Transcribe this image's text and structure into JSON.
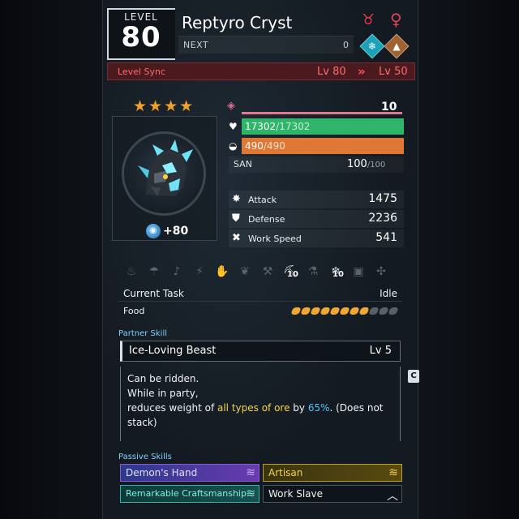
{
  "header": {
    "level_label": "LEVEL",
    "level": "80",
    "name": "Reptyro Cryst",
    "next_label": "NEXT",
    "next_value": "0",
    "level_sync_label": "Level Sync",
    "sync_from": "Lv 80",
    "sync_to": "Lv 50"
  },
  "icons": {
    "alpha": "alpha-icon",
    "gender": "female-icon",
    "element_1": "ice-element-icon",
    "element_2": "ground-element-icon"
  },
  "colors": {
    "ice_element": "#1aa3b8",
    "ground_element": "#a0622f",
    "hp_bar": "#2fb56a",
    "sp_bar": "#e07835",
    "sync_bar": "#4a1a1f"
  },
  "portrait": {
    "stars": "★★★★",
    "star_count": 4,
    "souls_bonus": "+80"
  },
  "stats": {
    "rank": "10",
    "hp_current": "17302",
    "hp_max": "/17302",
    "sp_current": "490",
    "sp_max": "/490",
    "san_label": "SAN",
    "san_value": "100",
    "san_max": "/100",
    "attack_label": "Attack",
    "attack": "1475",
    "defense_label": "Defense",
    "defense": "2236",
    "work_speed_label": "Work Speed",
    "work_speed": "541"
  },
  "work": {
    "icons": [
      {
        "name": "kindling-icon",
        "glyph": "♨",
        "active": false,
        "level": ""
      },
      {
        "name": "watering-icon",
        "glyph": "☂",
        "active": false,
        "level": ""
      },
      {
        "name": "planting-icon",
        "glyph": "♪",
        "active": false,
        "level": ""
      },
      {
        "name": "electricity-icon",
        "glyph": "⚡",
        "active": false,
        "level": ""
      },
      {
        "name": "handiwork-icon",
        "glyph": "✋",
        "active": false,
        "level": ""
      },
      {
        "name": "gathering-icon",
        "glyph": "❦",
        "active": false,
        "level": ""
      },
      {
        "name": "lumbering-icon",
        "glyph": "⚒",
        "active": false,
        "level": ""
      },
      {
        "name": "mining-icon",
        "glyph": "⛏",
        "active": true,
        "level": "10"
      },
      {
        "name": "medicine-icon",
        "glyph": "⚗",
        "active": false,
        "level": ""
      },
      {
        "name": "cooling-icon",
        "glyph": "❄",
        "active": true,
        "level": "10"
      },
      {
        "name": "transporting-icon",
        "glyph": "▣",
        "active": false,
        "level": ""
      },
      {
        "name": "farming-icon",
        "glyph": "✣",
        "active": false,
        "level": ""
      }
    ],
    "current_task_label": "Current Task",
    "current_task": "Idle",
    "food_label": "Food",
    "food_filled": 8,
    "food_total": 11
  },
  "partner_skill": {
    "section_label": "Partner Skill",
    "name": "Ice-Loving Beast",
    "level": "Lv  5",
    "line1": "Can be ridden.",
    "line2": "While in party,",
    "line3_a": "reduces weight of ",
    "line3_hl": "all types of ore",
    "line3_b": " by ",
    "line3_pct": "65%",
    "line3_c": ". (Does not stack)",
    "side_button": "C"
  },
  "passive_skills": {
    "section_label": "Passive Skills",
    "items": [
      {
        "name": "Demon's Hand",
        "rank": "≋"
      },
      {
        "name": "Artisan",
        "rank": "≋"
      },
      {
        "name": "Remarkable Craftsmanship",
        "rank": "≋"
      },
      {
        "name": "Work Slave",
        "rank": "︿"
      }
    ]
  }
}
